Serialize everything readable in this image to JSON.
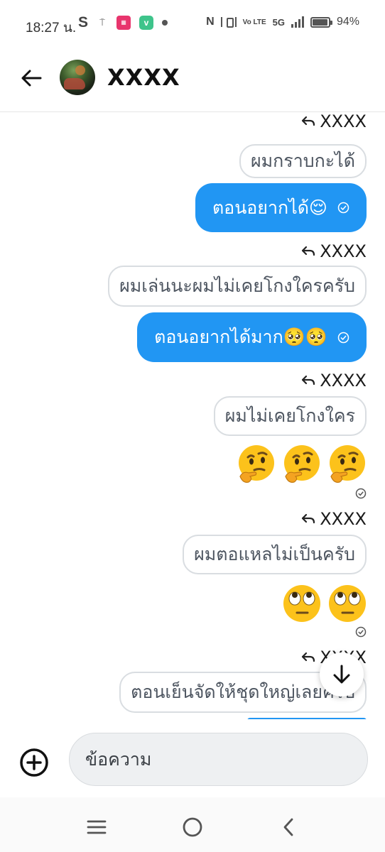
{
  "status_bar": {
    "time": "18:27 น.",
    "network": "5G",
    "volte": "Vo LTE",
    "battery": "94%",
    "battery_level": 0.94
  },
  "header": {
    "contact_name": "XXXX"
  },
  "messages": [
    {
      "type": "reply_label",
      "text": "XXXX"
    },
    {
      "type": "incoming",
      "text": "ผมกราบกะได้"
    },
    {
      "type": "outgoing",
      "text": "ตอนอยากได้😌"
    },
    {
      "type": "reply_label",
      "text": "XXXX"
    },
    {
      "type": "incoming",
      "text": "ผมเล่นนะผมไม่เคยโกงใครครับ"
    },
    {
      "type": "outgoing",
      "text": "ตอนอยากได้มาก🥺🥺"
    },
    {
      "type": "reply_label",
      "text": "XXXX"
    },
    {
      "type": "incoming",
      "text": "ผมไม่เคยโกงใคร"
    },
    {
      "type": "emoji",
      "emojis": [
        "thinking-face",
        "thinking-face",
        "thinking-face"
      ]
    },
    {
      "type": "reply_label",
      "text": "XXXX"
    },
    {
      "type": "incoming",
      "text": "ผมตอแหลไม่เป็นครับ"
    },
    {
      "type": "emoji",
      "emojis": [
        "rolling-eyes-face",
        "rolling-eyes-face"
      ]
    },
    {
      "type": "reply_label",
      "text": "XXXX"
    },
    {
      "type": "incoming",
      "text": "ตอนเย็นจัดให้ชุดใหญ่เลยครับ"
    }
  ],
  "composer": {
    "placeholder": "ข้อความ"
  },
  "colors": {
    "outgoing_bubble": "#2196f3",
    "incoming_border": "#d9dde1",
    "incoming_text": "#4d5560"
  },
  "icons": {
    "back": "arrow-left-icon",
    "add": "plus-circle-icon",
    "scroll_down": "arrow-down-icon",
    "nav_recents": "menu-lines-icon",
    "nav_home": "circle-icon",
    "nav_back": "chevron-left-icon"
  }
}
